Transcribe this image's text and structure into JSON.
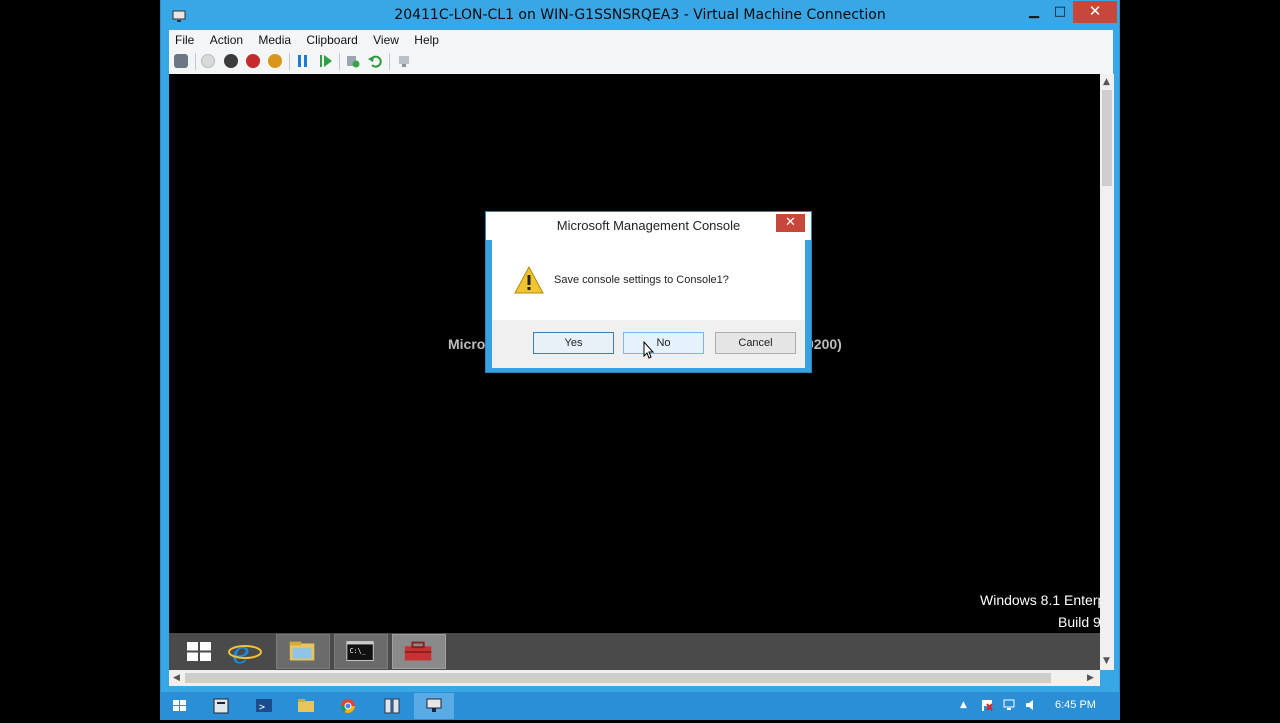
{
  "window": {
    "title": "20411C-LON-CL1 on WIN-G1SSNSRQEA3 - Virtual Machine Connection",
    "minimize": "▁",
    "maximize": "□",
    "close": "✕"
  },
  "menu": [
    "File",
    "Action",
    "Media",
    "Clipboard",
    "View",
    "Help"
  ],
  "toolbar_icons": [
    "ctrl-alt-del-icon",
    "start-icon",
    "turn-off-icon",
    "shut-down-icon",
    "save-icon",
    "pause-icon",
    "resume-icon",
    "checkpoint-icon",
    "revert-icon",
    "enhanced-session-icon"
  ],
  "guest": {
    "background_text_left": "Micro",
    "background_text_right": "9200)",
    "watermark_line1": "Windows 8.1 Enterp",
    "watermark_line2": "Build 9",
    "taskbar_items": [
      "start-icon",
      "internet-explorer-icon",
      "file-explorer-icon",
      "command-prompt-icon",
      "toolbox-icon"
    ]
  },
  "dialog": {
    "title": "Microsoft Management Console",
    "close": "✕",
    "message": "Save console settings to Console1?",
    "buttons": {
      "yes": "Yes",
      "no": "No",
      "cancel": "Cancel"
    }
  },
  "host_taskbar": {
    "items": [
      "start-icon",
      "server-manager-icon",
      "powershell-icon",
      "file-explorer-icon",
      "chrome-icon",
      "hyperv-manager-icon",
      "vm-connection-icon"
    ],
    "clock": "6:45 PM",
    "tray_arrow": "▲"
  },
  "colors": {
    "window_frame": "#39a6e6",
    "close_red": "#c7483b",
    "host_taskbar": "#2b8fd6",
    "guest_taskbar": "#4a4a4a"
  }
}
